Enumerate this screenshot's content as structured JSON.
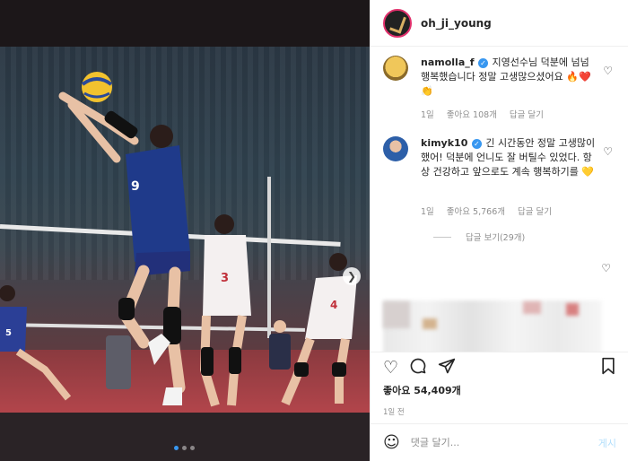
{
  "header": {
    "username": "oh_ji_young"
  },
  "comments": [
    {
      "username": "namolla_f",
      "text": "지영선수님 덕분에 넘넘 행복했습니다 정말 고생많으셨어요 🔥❤️👏",
      "age": "1일",
      "likes": "좋아요 108개",
      "reply": "답글 달기",
      "avatar_color": "#d9b24a"
    },
    {
      "username": "kimyk10",
      "text": "긴 시간동안 정말 고생많이했어! 덕분에 언니도 잘 버틸수 있었다. 항상 건강하고 앞으로도 계속 행복하기를 💛",
      "age": "1일",
      "likes": "좋아요 5,766개",
      "reply": "답글 달기",
      "view_replies": "답글 보기(29개)",
      "avatar_color": "#3a6fb0"
    }
  ],
  "post": {
    "likes": "좋아요 54,409개",
    "time": "1일 전"
  },
  "input": {
    "placeholder": "댓글 달기...",
    "post_label": "게시"
  },
  "carousel": {
    "next_icon": "chevron-right-icon",
    "pages": 3,
    "current": 1
  },
  "colors": {
    "accent": "#3897f0",
    "muted": "#8e8e8e"
  }
}
